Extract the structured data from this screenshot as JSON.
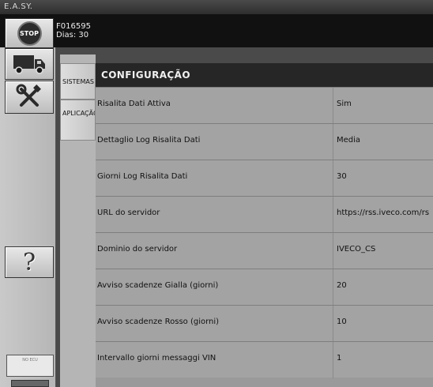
{
  "app": {
    "title": "E.A.SY."
  },
  "vehicle": {
    "id": "F016595",
    "days": "Dias: 30"
  },
  "sidebar": {
    "stop_label": "STOP",
    "truck_icon": "truck-icon",
    "tools_icon": "tools-icon",
    "help_label": "?",
    "ecu_label": "NO ECU"
  },
  "tabs": [
    {
      "label": "SISTEMAS"
    },
    {
      "label": "APLICAÇÃO"
    }
  ],
  "panel": {
    "title": "CONFIGURAÇÃO"
  },
  "settings": [
    {
      "label": "Risalita Dati Attiva",
      "value": "Sim"
    },
    {
      "label": "Dettaglio Log Risalita Dati",
      "value": "Media"
    },
    {
      "label": "Giorni Log Risalita Dati",
      "value": "30"
    },
    {
      "label": "URL do servidor",
      "value": "https://rss.iveco.com/rs"
    },
    {
      "label": "Dominio do servidor",
      "value": "IVECO_CS"
    },
    {
      "label": "Avviso scadenze Gialla (giorni)",
      "value": "20"
    },
    {
      "label": "Avviso scadenze Rosso (giorni)",
      "value": "10"
    },
    {
      "label": "Intervallo giorni messaggi VIN",
      "value": "1"
    }
  ]
}
